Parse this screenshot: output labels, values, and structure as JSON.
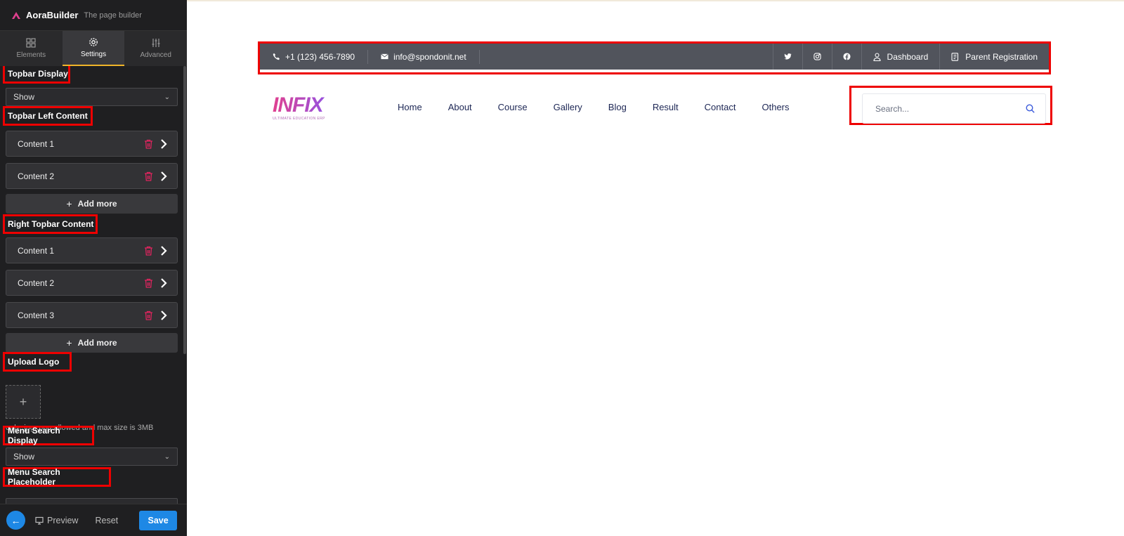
{
  "app": {
    "name": "AoraBuilder",
    "tagline": "The page builder"
  },
  "tabs": [
    {
      "label": "Elements",
      "icon": "grid-icon"
    },
    {
      "label": "Settings",
      "icon": "gear-icon",
      "active": true
    },
    {
      "label": "Advanced",
      "icon": "sliders-icon"
    }
  ],
  "settings": {
    "topbar_display": {
      "label": "Topbar Display",
      "value": "Show"
    },
    "topbar_left": {
      "label": "Topbar Left Content",
      "items": [
        "Content 1",
        "Content 2"
      ],
      "add_label": "Add more"
    },
    "topbar_right": {
      "label": "Right Topbar Content",
      "items": [
        "Content 1",
        "Content 2",
        "Content 3"
      ],
      "add_label": "Add more"
    },
    "upload_logo": {
      "label": "Upload Logo",
      "hint": "only .jpg,.png allowed and max size is 3MB"
    },
    "menu_search_display": {
      "label": "Menu Search Display",
      "value": "Show"
    },
    "menu_search_placeholder": {
      "label": "Menu Search Placeholder"
    }
  },
  "bottom_bar": {
    "preview": "Preview",
    "reset": "Reset",
    "save": "Save"
  },
  "preview_page": {
    "topbar": {
      "phone": "+1 (123) 456-7890",
      "email": "info@spondonit.net",
      "social": [
        "twitter-icon",
        "instagram-icon",
        "facebook-icon"
      ],
      "links": [
        {
          "label": "Dashboard",
          "icon": "user-icon"
        },
        {
          "label": "Parent Registration",
          "icon": "register-icon"
        }
      ]
    },
    "logo": {
      "text": "INFIX",
      "subtitle": "ULTIMATE EDUCATION ERP"
    },
    "nav": [
      "Home",
      "About",
      "Course",
      "Gallery",
      "Blog",
      "Result",
      "Contact",
      "Others"
    ],
    "search": {
      "placeholder": "Search..."
    }
  },
  "colors": {
    "accent": "#1e88e5",
    "highlight": "#ee0000",
    "tab_underline": "#f0b429",
    "topbar_bg": "#51545c",
    "trash": "#e0245e"
  }
}
